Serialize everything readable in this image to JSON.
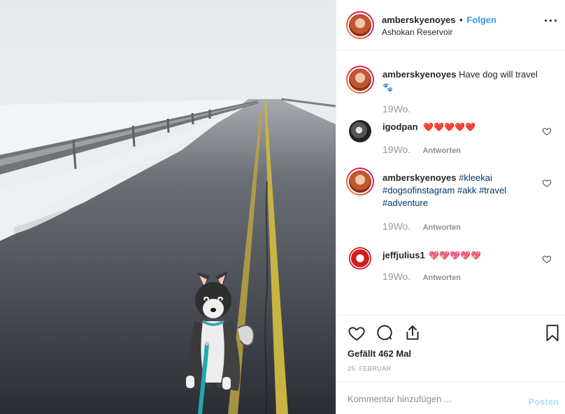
{
  "post": {
    "author": "amberskyenoyes",
    "separator": "•",
    "follow_label": "Folgen",
    "location": "Ashokan Reservoir",
    "caption": "Have dog will travel",
    "caption_emoji": "🐾",
    "caption_age": "19Wo."
  },
  "comments": [
    {
      "user": "igodpan",
      "text": "❤️❤️❤️❤️❤️",
      "age": "19Wo.",
      "reply": "Antworten"
    },
    {
      "user": "amberskyenoyes",
      "tags": [
        "#kleekai",
        "#dogsofinstagram",
        "#akk",
        "#travel",
        "#adventure"
      ],
      "age": "19Wo.",
      "reply": "Antworten"
    },
    {
      "user": "jeffjulius1",
      "text": "💖💖💖💖💖",
      "age": "19Wo.",
      "reply": "Antworten"
    }
  ],
  "actions": {
    "likes_text": "Gefällt 462 Mal",
    "date": "25. FEBRUAR"
  },
  "add_comment": {
    "placeholder": "Kommentar hinzufügen ...",
    "post_label": "Posten"
  },
  "icons": [
    "more-options-icon",
    "heart-icon",
    "comment-icon",
    "share-icon",
    "bookmark-icon"
  ]
}
